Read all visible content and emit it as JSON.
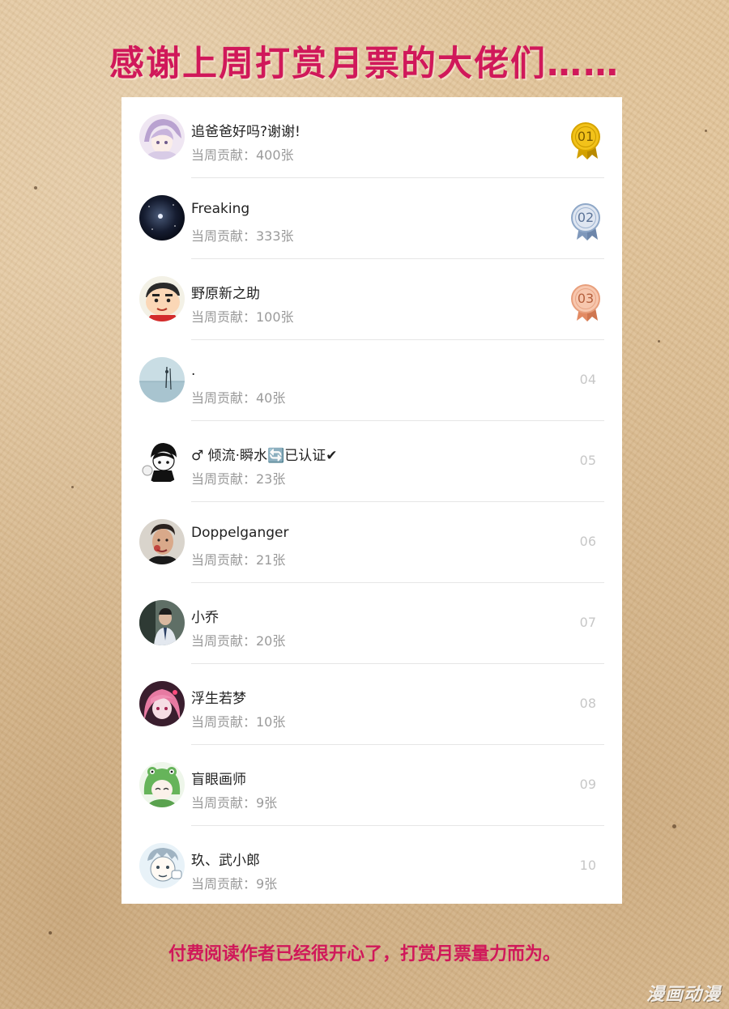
{
  "header": {
    "title": "感谢上周打赏月票的大佬们……"
  },
  "footer": {
    "text": "付费阅读作者已经很开心了，打赏月票量力而为。"
  },
  "watermark": "漫画动漫",
  "colors": {
    "accent": "#d0185a",
    "gold": "#e8b400",
    "silver": "#8fa8c8",
    "bronze": "#e89f7c"
  },
  "ranking": [
    {
      "name": "追爸爸好吗?谢谢!",
      "contribution": "当周贡献：400张",
      "rank": "01",
      "medal": "gold",
      "avatar": "anime-girl-purple-avatar"
    },
    {
      "name": "Freaking",
      "contribution": "当周贡献：333张",
      "rank": "02",
      "medal": "silver",
      "avatar": "night-sky-avatar"
    },
    {
      "name": "野原新之助",
      "contribution": "当周贡献：100张",
      "rank": "03",
      "medal": "bronze",
      "avatar": "crayon-shinchan-avatar"
    },
    {
      "name": ".",
      "contribution": "当周贡献：40张",
      "rank": "04",
      "avatar": "seascape-avatar"
    },
    {
      "name": "♂ 倾流·瞬水🔄已认证✔",
      "contribution": "当周贡献：23张",
      "rank": "05",
      "avatar": "cartoon-boy-avatar"
    },
    {
      "name": "Doppelganger",
      "contribution": "当周贡献：21张",
      "rank": "06",
      "avatar": "man-portrait-avatar"
    },
    {
      "name": "小乔",
      "contribution": "当周贡献：20张",
      "rank": "07",
      "avatar": "person-photo-avatar"
    },
    {
      "name": "浮生若梦",
      "contribution": "当周贡献：10张",
      "rank": "08",
      "avatar": "pink-anime-avatar"
    },
    {
      "name": "盲眼画师",
      "contribution": "当周贡献：9张",
      "rank": "09",
      "avatar": "green-frog-hood-avatar"
    },
    {
      "name": "玖、武小郎",
      "contribution": "当周贡献：9张",
      "rank": "10",
      "avatar": "cartoon-sketch-avatar"
    }
  ]
}
